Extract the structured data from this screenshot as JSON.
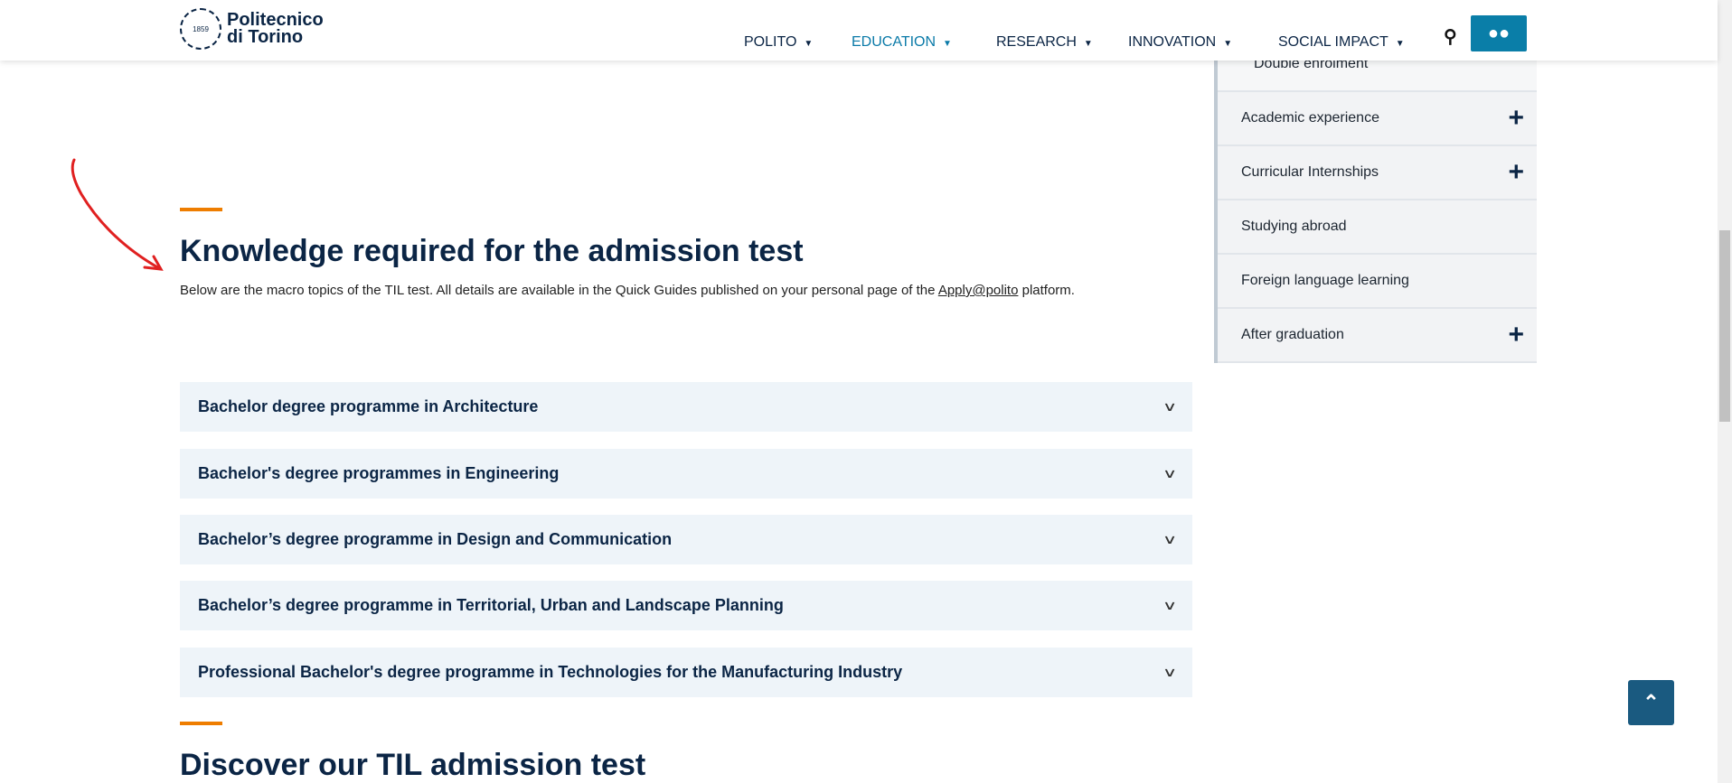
{
  "header": {
    "logo_line1": "Politecnico",
    "logo_line2": "di Torino",
    "seal_year": "1859",
    "nav": [
      {
        "label": "POLITO",
        "active": false
      },
      {
        "label": "EDUCATION",
        "active": true
      },
      {
        "label": "RESEARCH",
        "active": false
      },
      {
        "label": "INNOVATION",
        "active": false
      },
      {
        "label": "SOCIAL IMPACT",
        "active": false
      }
    ],
    "search_icon": "search-icon",
    "user_icon": "users-icon",
    "accent": "#0a7ea8"
  },
  "sidebar": {
    "items": [
      {
        "label": "Double enrolment",
        "expandable": false
      },
      {
        "label": "Academic experience",
        "expandable": true
      },
      {
        "label": "Curricular Internships",
        "expandable": true
      },
      {
        "label": "Studying abroad",
        "expandable": false
      },
      {
        "label": "Foreign language learning",
        "expandable": false
      },
      {
        "label": "After graduation",
        "expandable": true
      }
    ]
  },
  "main": {
    "title": "Knowledge required for the admission test",
    "desc_before": "Below are the macro topics of the TIL test.  All details are available in the Quick Guides published on your personal page of the ",
    "desc_link": "Apply@polito",
    "desc_after": " platform.",
    "accordions": [
      "Bachelor degree programme in Architecture",
      "Bachelor's degree programmes in Engineering",
      "Bachelor’s degree programme in Design and Communication",
      "Bachelor’s degree programme in Territorial, Urban and Landscape Planning",
      "Professional Bachelor's degree programme in Technologies for the Manufacturing Industry"
    ],
    "next_title": "Discover our TIL admission test"
  },
  "colors": {
    "heading": "#0b2545",
    "orange": "#ee7d00",
    "annotation": "#e02020"
  }
}
